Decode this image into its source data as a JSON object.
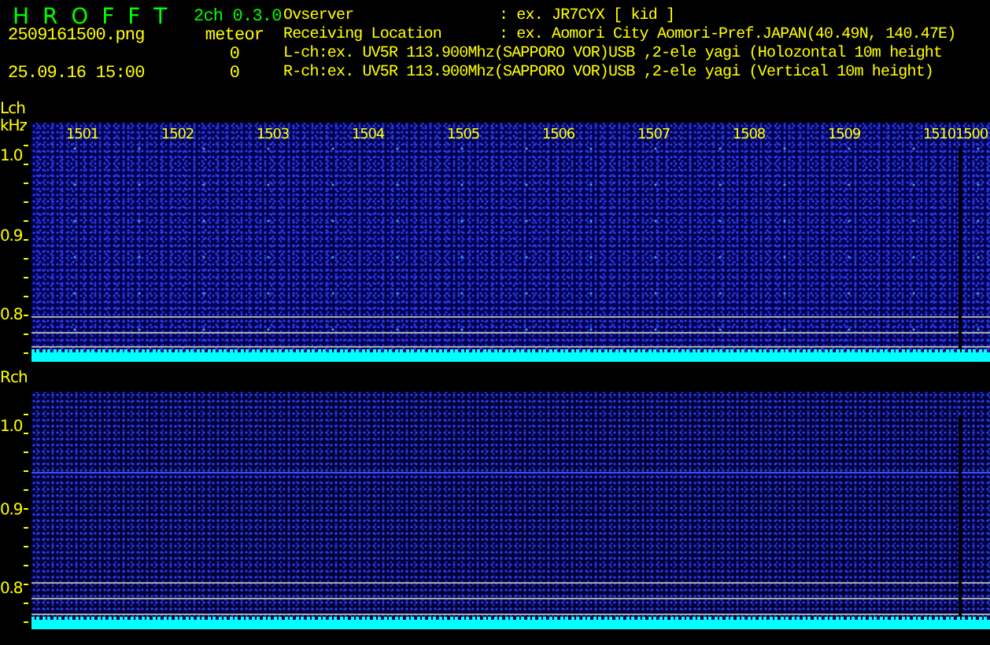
{
  "header": {
    "app_title": "H R O F F T",
    "version": "2ch 0.3.0",
    "file_name": "2509161500.png",
    "timestamp": "25.09.16 15:00",
    "meteor_label": "meteor",
    "meteor_counts": [
      "0",
      "0"
    ],
    "info": [
      {
        "label": "Ovserver",
        "value": ": ex. JR7CYX [ kid ]"
      },
      {
        "label": "Receiving Location",
        "value": ": ex. Aomori City Aomori-Pref.JAPAN(40.49N, 140.47E)"
      }
    ],
    "channels": [
      "L-ch:ex. UV5R 113.900Mhz(SAPPORO VOR)USB ,2-ele yagi (Holozontal 10m height",
      "R-ch:ex. UV5R 113.900Mhz(SAPPORO VOR)USB ,2-ele yagi (Vertical 10m height)"
    ]
  },
  "panels": [
    {
      "label": "Lch",
      "unit": "kHz",
      "time_labels": [
        "1501",
        "1502",
        "1503",
        "1504",
        "1505",
        "1506",
        "1507",
        "1508",
        "1509",
        "1510",
        "1500"
      ],
      "y_labels": [
        "1.0",
        "0.9",
        "0.8"
      ]
    },
    {
      "label": "Rch",
      "y_labels": [
        "1.0",
        "0.9",
        "0.8"
      ]
    }
  ]
}
